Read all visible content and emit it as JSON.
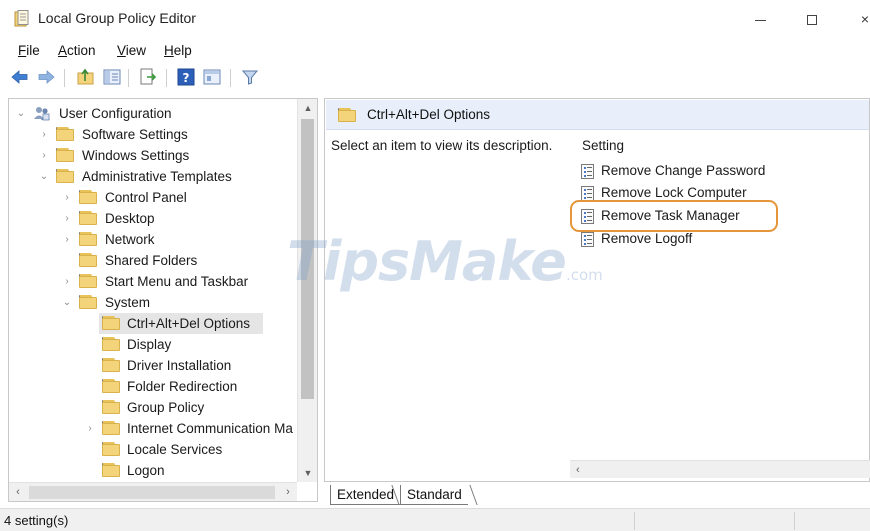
{
  "window": {
    "title": "Local Group Policy Editor",
    "minimize_icon": "minimize-icon",
    "maximize_icon": "maximize-icon",
    "close_glyph": "×"
  },
  "menu": {
    "file": {
      "u": "F",
      "rest": "ile"
    },
    "action": {
      "u": "A",
      "rest": "ction"
    },
    "view": {
      "u": "V",
      "rest": "iew"
    },
    "help": {
      "u": "H",
      "rest": "elp"
    }
  },
  "toolbar": {
    "icons": [
      "back-arrow-icon",
      "forward-arrow-icon",
      "up-folder-icon",
      "show-hide-tree-icon",
      "export-list-icon",
      "help-icon",
      "properties-view-icon",
      "filter-icon"
    ]
  },
  "tree": {
    "root": "User Configuration",
    "items": [
      {
        "label": "Software Settings"
      },
      {
        "label": "Windows Settings"
      },
      {
        "label": "Administrative Templates"
      },
      {
        "label": "Control Panel"
      },
      {
        "label": "Desktop"
      },
      {
        "label": "Network"
      },
      {
        "label": "Shared Folders"
      },
      {
        "label": "Start Menu and Taskbar"
      },
      {
        "label": "System"
      },
      {
        "label": "Ctrl+Alt+Del Options"
      },
      {
        "label": "Display"
      },
      {
        "label": "Driver Installation"
      },
      {
        "label": "Folder Redirection"
      },
      {
        "label": "Group Policy"
      },
      {
        "label": "Internet Communication Ma"
      },
      {
        "label": "Locale Services"
      },
      {
        "label": "Logon"
      }
    ]
  },
  "right": {
    "header_title": "Ctrl+Alt+Del Options",
    "description": "Select an item to view its description.",
    "column_header": "Setting",
    "settings": [
      {
        "label": "Remove Change Password"
      },
      {
        "label": "Remove Lock Computer"
      },
      {
        "label": "Remove Task Manager"
      },
      {
        "label": "Remove Logoff"
      }
    ]
  },
  "watermark": {
    "main": "TipsMake",
    "suffix": ".com"
  },
  "tabs": {
    "extended": "Extended",
    "standard": "Standard"
  },
  "status": {
    "text": "4 setting(s)"
  },
  "colors": {
    "highlight_ring": "#e6963a",
    "header_bg": "#e8eefa",
    "folder": "#f4d47a"
  }
}
